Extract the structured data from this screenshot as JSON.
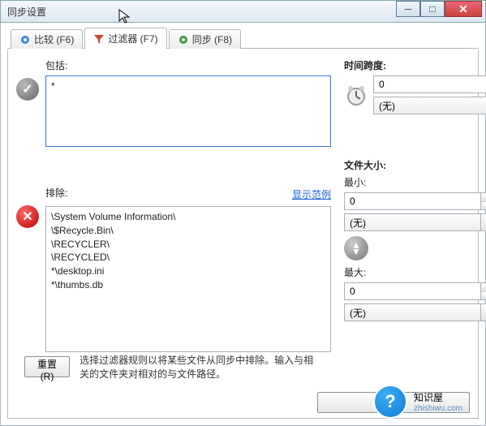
{
  "window": {
    "title": "同步设置"
  },
  "tabs": {
    "compare": "比较 (F6)",
    "filter": "过滤器 (F7)",
    "sync": "同步 (F8)"
  },
  "include": {
    "label": "包括:",
    "value": "*"
  },
  "exclude": {
    "label": "排除:",
    "show_example": "显示范例",
    "value": "\\System Volume Information\\\n\\$Recycle.Bin\\\n\\RECYCLER\\\n\\RECYCLED\\\n*\\desktop.ini\n*\\thumbs.db"
  },
  "timespan": {
    "label": "时间跨度:",
    "value": "0",
    "unit": "(无)"
  },
  "filesize": {
    "label": "文件大小:",
    "min_label": "最小:",
    "min_value": "0",
    "min_unit": "(无)",
    "max_label": "最大:",
    "max_value": "0",
    "max_unit": "(无)"
  },
  "footer": {
    "reset": "重置(R)",
    "hint": "选择过滤器规则以将某些文件从同步中排除。输入与相关的文件夹对相对的与文件路径。"
  },
  "watermark": {
    "brand": "知识屋",
    "url": "zhishiwu.com"
  }
}
